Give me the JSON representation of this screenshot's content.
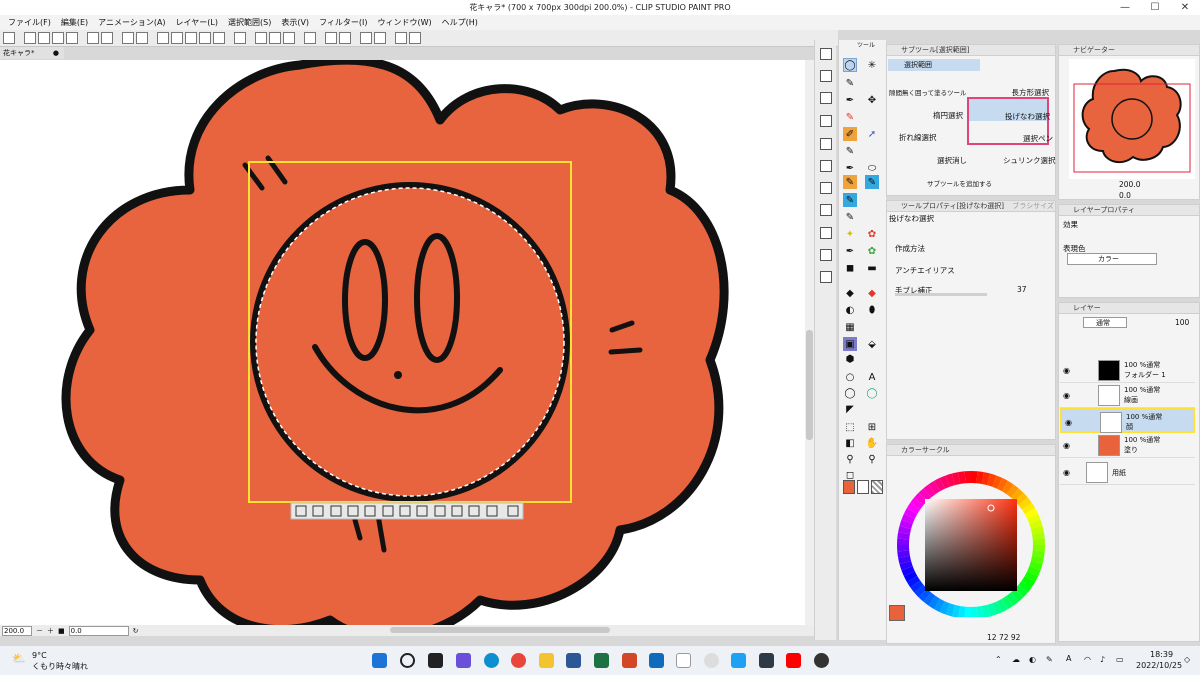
{
  "window": {
    "title": "花キャラ* (700 x 700px 300dpi 200.0%) - CLIP STUDIO PAINT PRO",
    "min": "—",
    "max": "☐",
    "close": "✕"
  },
  "menu": [
    "ファイル(F)",
    "編集(E)",
    "アニメーション(A)",
    "レイヤー(L)",
    "選択範囲(S)",
    "表示(V)",
    "フィルター(I)",
    "ウィンドウ(W)",
    "ヘルプ(H)"
  ],
  "document_tab": "花キャラ*",
  "status": {
    "zoom": "200.0",
    "angle": "0.0"
  },
  "tool_panel": {
    "title": "ツール"
  },
  "subtool_panel": {
    "title": "サブツール[選択範囲]",
    "group": "選択範囲",
    "items": [
      "長方形選択",
      "隙間無く囲って塗るツール",
      "楕円選択",
      "投げなわ選択",
      "折れ線選択",
      "選択ペン",
      "選択消し",
      "シュリンク選択"
    ],
    "add_label": "サブツールを追加する"
  },
  "tool_property": {
    "title": "ツールプロパティ[投げなわ選択]",
    "title2": "ブラシサイズ",
    "tool_name": "投げなわ選択",
    "rows": [
      {
        "label": "作成方法"
      },
      {
        "label": "アンチエイリアス"
      },
      {
        "label": "手ブレ補正",
        "value": "37"
      }
    ]
  },
  "color_panel": {
    "title": "カラーサークル",
    "main_color": "#e8623c",
    "readout": [
      "12",
      "72",
      "92"
    ]
  },
  "navigator": {
    "title": "ナビゲーター",
    "zoom": "200.0",
    "angle": "0.0"
  },
  "layer_property": {
    "title": "レイヤープロパティ",
    "effect_label": "効果",
    "expression_label": "表現色",
    "expression_value": "カラー"
  },
  "layers": {
    "title": "レイヤー",
    "blend": "通常",
    "opacity": "100",
    "rows": [
      {
        "line1": "100 %通常",
        "line2": "フォルダー 1"
      },
      {
        "line1": "100 %通常",
        "line2": "線画"
      },
      {
        "line1": "100 %通常",
        "line2": "顔"
      },
      {
        "line1": "100 %通常",
        "line2": "塗り"
      },
      {
        "line1": "",
        "line2": "用紙"
      }
    ]
  },
  "taskbar": {
    "weather_temp": "9°C",
    "weather_text": "くもり時々晴れ",
    "ime": "A",
    "time": "18:39",
    "date": "2022/10/25"
  },
  "colors": {
    "flower": "#e8643e",
    "selection": "#ffe033",
    "highlight": "#e0457a",
    "active_layer": "#c6dbf0"
  }
}
